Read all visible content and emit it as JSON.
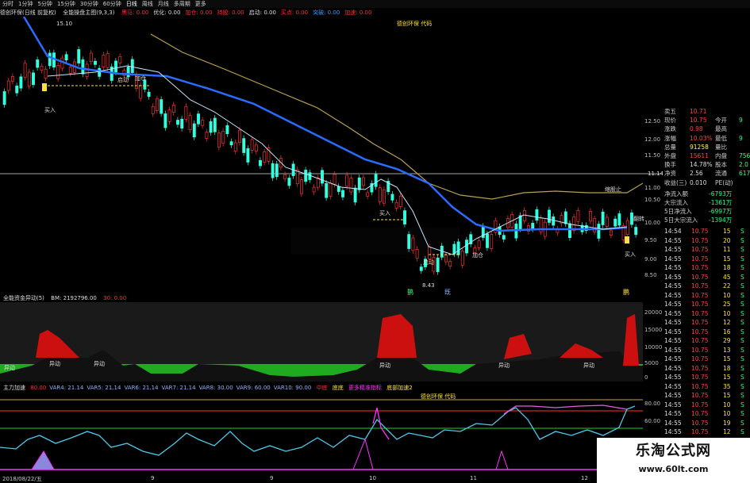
{
  "toolbar": {
    "periods": [
      "分时",
      "1分钟",
      "5分钟",
      "15分钟",
      "30分钟",
      "60分钟",
      "日线",
      "周线",
      "月线",
      "多周期",
      "更多"
    ],
    "active": "日线"
  },
  "main_info": {
    "title": "德创环保(日线 前复权)",
    "indicator": "全能操盘主图(9,3,3)",
    "items": [
      {
        "text": "黑马: 0.00",
        "color": "#ff3030"
      },
      {
        "text": "优化: 0.00",
        "color": "#dddddd"
      },
      {
        "text": "加仓: 0.00",
        "color": "#ff3030"
      },
      {
        "text": "持股: 0.00",
        "color": "#ff3030"
      },
      {
        "text": "启动: 0.00",
        "color": "#dddddd"
      },
      {
        "text": "买点: 0.00",
        "color": "#ff3030"
      },
      {
        "text": "突破: 0.00",
        "color": "#3399ff"
      },
      {
        "text": "加速: 0.00",
        "color": "#ff3030"
      }
    ],
    "ma_value": "15.10"
  },
  "main_labels": {
    "buy1": "买入",
    "buy2": "买入",
    "buy3": "买入",
    "start1": "启动",
    "start2": "启动",
    "low_price": "8.43",
    "high_price": "15.10",
    "add1": "加仓",
    "add2": "加仓",
    "signal1": "缩股止",
    "signal2": "翻转",
    "crosshair": "11.14",
    "watermark_label": "德创环保 代码",
    "bottom_glyph1": "鹊",
    "bottom_glyph2": "既",
    "bottom_glyph3": "鹏"
  },
  "price_axis": [
    "12.50",
    "12.00",
    "11.50",
    "11.00",
    "10.50",
    "10.00",
    "9.50",
    "9.00",
    "8.50"
  ],
  "panel2": {
    "title": "全能资金异动(5)",
    "value": "BM: 2192796.00",
    "value2": "30: 0.00",
    "labels": [
      "异动",
      "异动",
      "异动",
      "异动",
      "异动",
      "异动"
    ],
    "axis": [
      "20000",
      "15000",
      "10000",
      "5000",
      "0",
      "-5000"
    ]
  },
  "panel3": {
    "title": "主力加速",
    "items": [
      "80.00",
      "VAR4: 21.14",
      "VAR5: 21.14",
      "VAR6: 21.14",
      "VAR7: 21.14",
      "VAR8: 30.00",
      "VAR9: 60.00",
      "VAR10: 90.00"
    ],
    "marks": [
      "中底",
      "底底",
      "更多精准指标",
      "底部加速2"
    ],
    "watermark": "德创环保 代码",
    "axis": [
      "80.00",
      "60.00"
    ]
  },
  "date_axis": [
    "2018/08/22/五",
    "9",
    "9",
    "10",
    "11",
    "12"
  ],
  "quote": {
    "rows": [
      {
        "l": "卖五",
        "v": "10.71",
        "r": "",
        "rv": "",
        "vc": "#ff4040"
      },
      {
        "l": "现价",
        "v": "10.75",
        "r": "今开",
        "rv": "9",
        "vc": "#ff4040"
      },
      {
        "l": "涨跌",
        "v": "0.98",
        "r": "最高",
        "rv": "",
        "vc": "#ff4040"
      },
      {
        "l": "涨幅",
        "v": "10.03%",
        "r": "最低",
        "rv": "9",
        "vc": "#ff4040"
      },
      {
        "l": "总量",
        "v": "91258",
        "r": "量比",
        "rv": "",
        "vc": "#ffff40"
      },
      {
        "l": "外盘",
        "v": "15611",
        "r": "内盘",
        "rv": "756",
        "vc": "#ff4040"
      },
      {
        "l": "换手",
        "v": "14.78%",
        "r": "股本",
        "rv": "2.0",
        "vc": "#dddddd"
      },
      {
        "l": "净资",
        "v": "2.56",
        "r": "流通",
        "rv": "6175",
        "vc": "#dddddd"
      },
      {
        "l": "收益(三)",
        "v": "0.010",
        "r": "PE(动)",
        "rv": "",
        "vc": "#dddddd"
      }
    ],
    "flows": [
      {
        "l": "净流入额",
        "v": "-6793万"
      },
      {
        "l": "大宗流入",
        "v": "-1361万"
      },
      {
        "l": "5日净流入",
        "v": "-6997万"
      },
      {
        "l": "5日大宗流入",
        "v": "-1394万"
      }
    ],
    "ticks": [
      {
        "t": "14:54",
        "p": "10.75",
        "v": "15",
        "d": "S"
      },
      {
        "t": "14:55",
        "p": "10.75",
        "v": "20",
        "d": "S"
      },
      {
        "t": "14:55",
        "p": "10.75",
        "v": "11",
        "d": "S"
      },
      {
        "t": "14:55",
        "p": "10.75",
        "v": "15",
        "d": "S"
      },
      {
        "t": "14:55",
        "p": "10.75",
        "v": "18",
        "d": "S"
      },
      {
        "t": "14:55",
        "p": "10.75",
        "v": "45",
        "d": "S"
      },
      {
        "t": "14:55",
        "p": "10.75",
        "v": "22",
        "d": "S"
      },
      {
        "t": "14:55",
        "p": "10.75",
        "v": "10",
        "d": "S"
      },
      {
        "t": "14:55",
        "p": "10.75",
        "v": "25",
        "d": "S"
      },
      {
        "t": "14:55",
        "p": "10.75",
        "v": "10",
        "d": "S"
      },
      {
        "t": "14:55",
        "p": "10.75",
        "v": "12",
        "d": "S"
      },
      {
        "t": "14:55",
        "p": "10.75",
        "v": "16",
        "d": "S"
      },
      {
        "t": "14:55",
        "p": "10.75",
        "v": "29",
        "d": "S"
      },
      {
        "t": "14:55",
        "p": "10.75",
        "v": "13",
        "d": "S"
      },
      {
        "t": "14:55",
        "p": "10.75",
        "v": "15",
        "d": "S"
      },
      {
        "t": "14:55",
        "p": "10.75",
        "v": "18",
        "d": "S"
      },
      {
        "t": "14:55",
        "p": "10.75",
        "v": "15",
        "d": "S"
      },
      {
        "t": "14:55",
        "p": "10.75",
        "v": "35",
        "d": "S"
      },
      {
        "t": "14:55",
        "p": "10.75",
        "v": "15",
        "d": "S"
      },
      {
        "t": "14:55",
        "p": "10.75",
        "v": "10",
        "d": "S"
      },
      {
        "t": "14:55",
        "p": "10.75",
        "v": "10",
        "d": "S"
      },
      {
        "t": "14:55",
        "p": "10.75",
        "v": "19",
        "d": "S"
      },
      {
        "t": "14:55",
        "p": "10.75",
        "v": "12",
        "d": "S"
      },
      {
        "t": "14:56",
        "p": "10.75",
        "v": "10",
        "d": "S"
      },
      {
        "t": "14:56",
        "p": "10.75",
        "v": "17",
        "d": "S"
      }
    ]
  },
  "watermark": {
    "line1": "乐淘公式网",
    "line2": "www.60lt.com"
  },
  "colors": {
    "up": "#ff3030",
    "down": "#30ffe0",
    "ma_blue": "#2a6cff",
    "ma_gold": "#b8a050",
    "green_area": "#1faa1f",
    "red_area": "#cc1010"
  }
}
